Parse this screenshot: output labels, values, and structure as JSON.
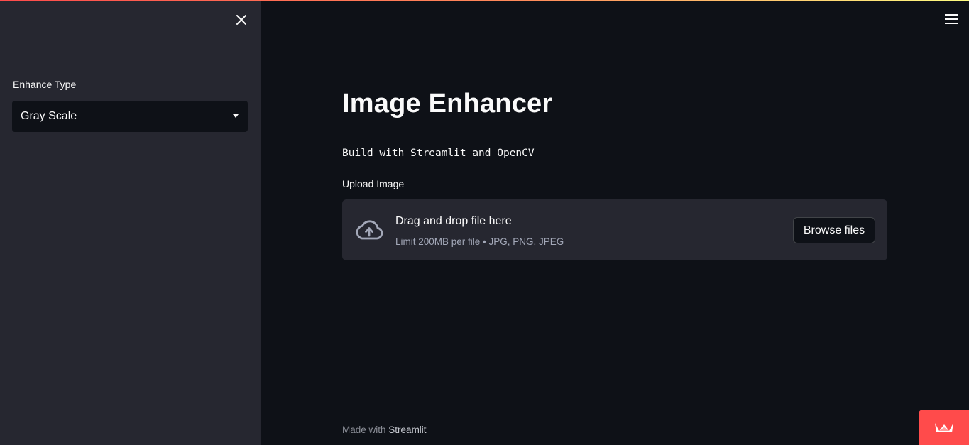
{
  "sidebar": {
    "select_label": "Enhance Type",
    "select_value": "Gray Scale",
    "close_icon": "close-icon"
  },
  "header": {
    "menu_icon": "hamburger-menu-icon"
  },
  "main": {
    "title": "Image Enhancer",
    "subtitle": "Build with Streamlit and OpenCV",
    "upload": {
      "label": "Upload Image",
      "drop_title": "Drag and drop file here",
      "limit_text": "Limit 200MB per file • JPG, PNG, JPEG",
      "browse_label": "Browse files",
      "icon": "cloud-upload-icon"
    }
  },
  "footer": {
    "prefix": "Made with",
    "link": "Streamlit"
  },
  "badge": {
    "icon": "streamlit-crown-icon"
  },
  "colors": {
    "background": "#0e1117",
    "sidebar": "#262730",
    "accent": "#ff4b4b",
    "text": "#fafafa",
    "muted": "#a3a8b8"
  }
}
